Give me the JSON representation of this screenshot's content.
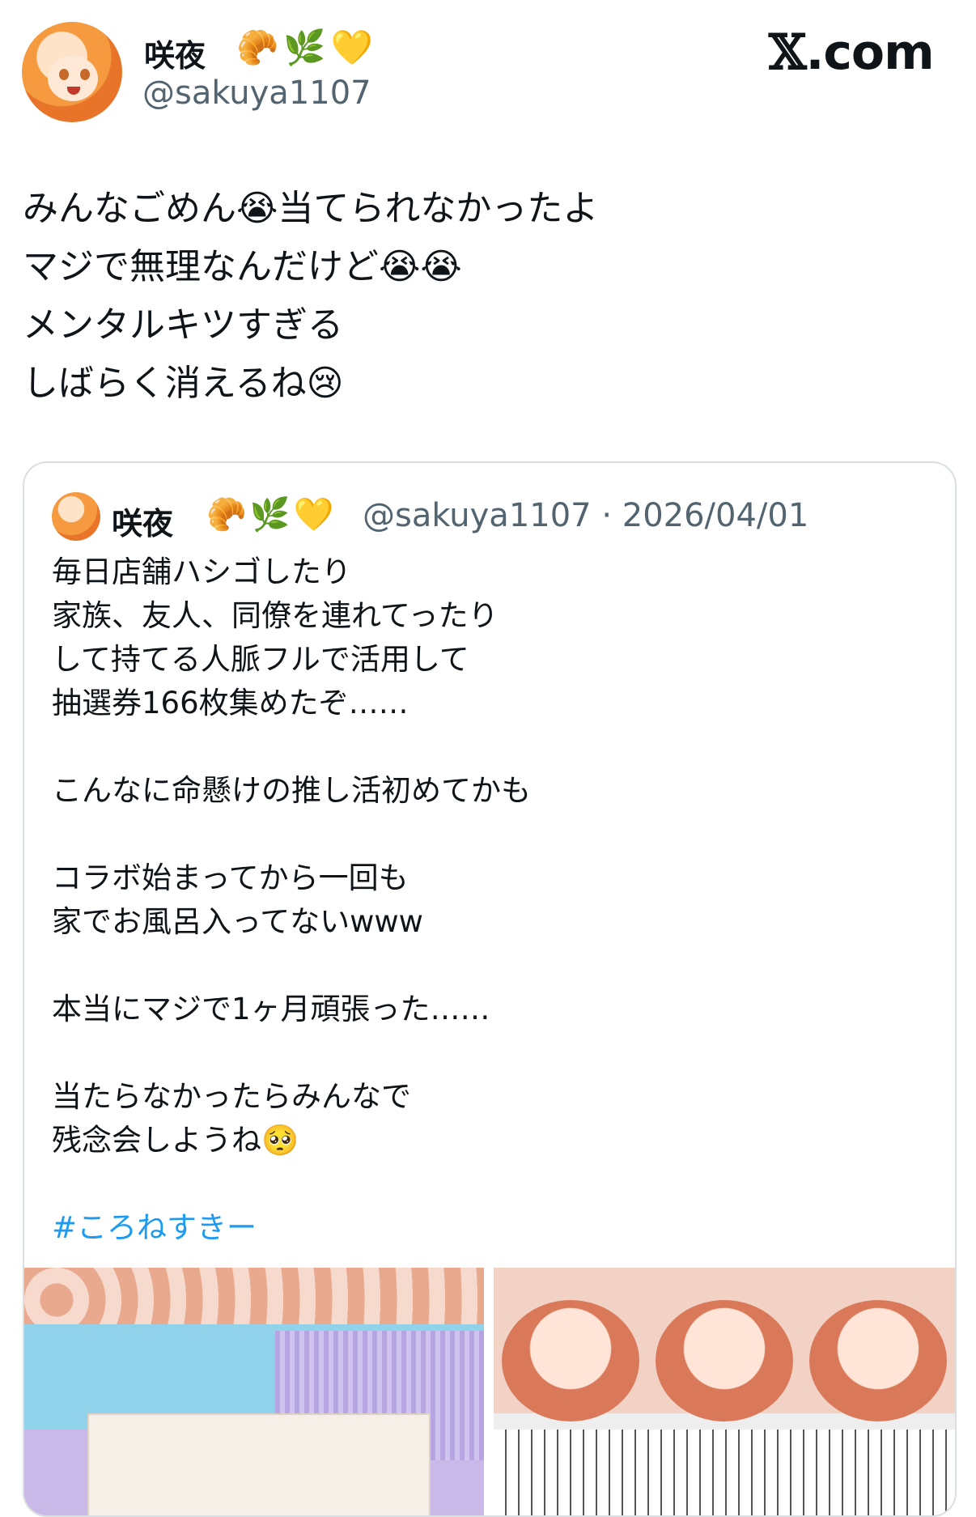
{
  "header": {
    "display_name": "咲夜",
    "name_emojis": "🥐🌿💛",
    "handle": "@sakuya1107",
    "brand_x": "𝕏",
    "brand_suffix": ".com"
  },
  "tweet": {
    "lines": [
      "みんなごめん😭当てられなかったよ",
      "マジで無理なんだけど😭😭",
      "メンタルキツすぎる",
      "しばらく消えるね😢"
    ]
  },
  "quoted_tweet": {
    "display_name": "咲夜",
    "name_emojis": "🥐🌿💛",
    "handle_date": "@sakuya1107 · 2026/04/01",
    "lines": [
      "毎日店舗ハシゴしたり",
      "家族、友人、同僚を連れてったり",
      "して持てる人脈フルで活用して",
      "抽選券166枚集めたぞ……",
      "",
      "こんなに命懸けの推し活初めてかも",
      "",
      "コラボ始まってから一回も",
      "家でお風呂入ってないwww",
      "",
      "本当にマジで1ヶ月頑張った……",
      "",
      "当たらなかったらみんなで",
      "残念会しようね🥺",
      ""
    ],
    "hashtag": "#ころねすきー"
  },
  "colors": {
    "link": "#1d9bf0",
    "secondary_text": "#536471",
    "border": "#d9dee2"
  }
}
